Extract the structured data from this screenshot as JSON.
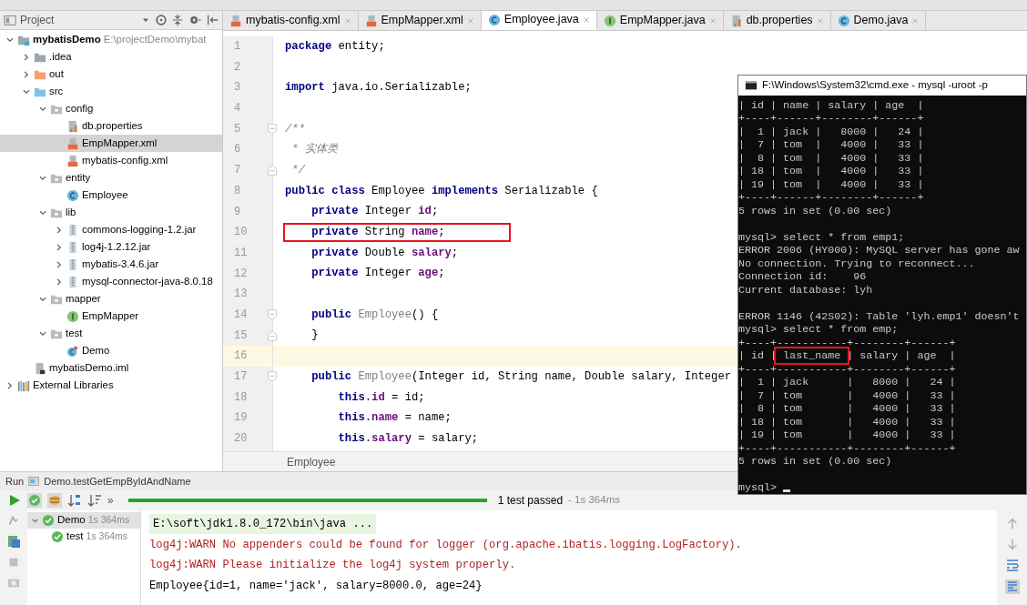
{
  "project_panel": {
    "title": "Project"
  },
  "tree": [
    {
      "label": "mybatisDemo",
      "hint": "E:\\projectDemo\\mybat",
      "kind": "module",
      "expanded": true,
      "selected": false,
      "children": [
        {
          "label": ".idea",
          "kind": "folder",
          "expanded": false,
          "selected": false
        },
        {
          "label": "out",
          "kind": "excluded",
          "expanded": false,
          "selected": false
        },
        {
          "label": "src",
          "kind": "source",
          "expanded": true,
          "selected": false,
          "children": [
            {
              "label": "config",
              "kind": "package",
              "expanded": true,
              "selected": false,
              "children": [
                {
                  "label": "db.properties",
                  "kind": "properties",
                  "selected": false
                },
                {
                  "label": "EmpMapper.xml",
                  "kind": "xml",
                  "selected": true
                },
                {
                  "label": "mybatis-config.xml",
                  "kind": "xml",
                  "selected": false
                }
              ]
            },
            {
              "label": "entity",
              "kind": "package",
              "expanded": true,
              "selected": false,
              "children": [
                {
                  "label": "Employee",
                  "kind": "class",
                  "selected": false
                }
              ]
            },
            {
              "label": "lib",
              "kind": "package",
              "expanded": true,
              "selected": false,
              "children": [
                {
                  "label": "commons-logging-1.2.jar",
                  "kind": "jar",
                  "expanded": false,
                  "selected": false
                },
                {
                  "label": "log4j-1.2.12.jar",
                  "kind": "jar",
                  "expanded": false,
                  "selected": false
                },
                {
                  "label": "mybatis-3.4.6.jar",
                  "kind": "jar",
                  "expanded": false,
                  "selected": false
                },
                {
                  "label": "mysql-connector-java-8.0.18",
                  "kind": "jar",
                  "expanded": false,
                  "selected": false
                }
              ]
            },
            {
              "label": "mapper",
              "kind": "package",
              "expanded": true,
              "selected": false,
              "children": [
                {
                  "label": "EmpMapper",
                  "kind": "interface",
                  "selected": false
                }
              ]
            },
            {
              "label": "test",
              "kind": "package",
              "expanded": true,
              "selected": false,
              "children": [
                {
                  "label": "Demo",
                  "kind": "testclass",
                  "selected": false
                }
              ]
            }
          ]
        },
        {
          "label": "mybatisDemo.iml",
          "kind": "iml",
          "selected": false
        }
      ]
    },
    {
      "label": "External Libraries",
      "kind": "libraries",
      "expanded": false,
      "selected": false
    }
  ],
  "editor_tabs": [
    {
      "label": "mybatis-config.xml",
      "kind": "xml",
      "selected": false
    },
    {
      "label": "EmpMapper.xml",
      "kind": "xml",
      "selected": false
    },
    {
      "label": "Employee.java",
      "kind": "class",
      "selected": true
    },
    {
      "label": "EmpMapper.java",
      "kind": "interface",
      "selected": false
    },
    {
      "label": "db.properties",
      "kind": "properties",
      "selected": false
    },
    {
      "label": "Demo.java",
      "kind": "class",
      "selected": false
    }
  ],
  "code_lines": [
    {
      "number": "1",
      "kind": "plain",
      "current": false,
      "boxed": false,
      "segments": [
        {
          "kind": "kw",
          "text": "package"
        },
        {
          "kind": "plain",
          "text": " entity;"
        }
      ]
    },
    {
      "number": "2",
      "kind": "plain",
      "current": false
    },
    {
      "number": "3",
      "kind": "plain",
      "current": false,
      "boxed": false,
      "segments": [
        {
          "kind": "kw",
          "text": "import"
        },
        {
          "kind": "plain",
          "text": " java.io.Serializable;"
        }
      ]
    },
    {
      "number": "4",
      "kind": "plain",
      "current": false
    },
    {
      "number": "5",
      "kind": "fold-start",
      "current": false,
      "boxed": false,
      "segments": [
        {
          "kind": "comment",
          "text": "/**"
        }
      ]
    },
    {
      "number": "6",
      "kind": "plain",
      "current": false,
      "boxed": false,
      "segments": [
        {
          "kind": "comment",
          "text": " * 实体类"
        }
      ]
    },
    {
      "number": "7",
      "kind": "fold-end",
      "current": false,
      "boxed": false,
      "segments": [
        {
          "kind": "comment",
          "text": " */"
        }
      ]
    },
    {
      "number": "8",
      "kind": "plain",
      "current": false,
      "boxed": false,
      "segments": [
        {
          "kind": "kw",
          "text": "public class"
        },
        {
          "kind": "plain",
          "text": " Employee "
        },
        {
          "kind": "kw",
          "text": "implements"
        },
        {
          "kind": "plain",
          "text": " Serializable {"
        }
      ]
    },
    {
      "number": "9",
      "kind": "plain",
      "current": false,
      "boxed": false,
      "segments": [
        {
          "kind": "kw",
          "text": "    private"
        },
        {
          "kind": "plain",
          "text": " Integer "
        },
        {
          "kind": "field",
          "text": "id"
        },
        {
          "kind": "plain",
          "text": ";"
        }
      ]
    },
    {
      "number": "10",
      "kind": "plain",
      "current": false,
      "boxed": true,
      "segments": [
        {
          "kind": "kw",
          "text": "    private"
        },
        {
          "kind": "plain",
          "text": " String "
        },
        {
          "kind": "field",
          "text": "name"
        },
        {
          "kind": "plain",
          "text": ";"
        }
      ]
    },
    {
      "number": "11",
      "kind": "plain",
      "current": false,
      "boxed": false,
      "segments": [
        {
          "kind": "kw",
          "text": "    private"
        },
        {
          "kind": "plain",
          "text": " Double "
        },
        {
          "kind": "field",
          "text": "salary"
        },
        {
          "kind": "plain",
          "text": ";"
        }
      ]
    },
    {
      "number": "12",
      "kind": "plain",
      "current": false,
      "boxed": false,
      "segments": [
        {
          "kind": "kw",
          "text": "    private"
        },
        {
          "kind": "plain",
          "text": " Integer "
        },
        {
          "kind": "field",
          "text": "age"
        },
        {
          "kind": "plain",
          "text": ";"
        }
      ]
    },
    {
      "number": "13",
      "kind": "plain",
      "current": false
    },
    {
      "number": "14",
      "kind": "fold-start",
      "current": false,
      "boxed": false,
      "segments": [
        {
          "kind": "kw",
          "text": "    public"
        },
        {
          "kind": "unused",
          "text": " Employee"
        },
        {
          "kind": "plain",
          "text": "() {"
        }
      ]
    },
    {
      "number": "15",
      "kind": "fold-end",
      "current": false,
      "boxed": false,
      "segments": [
        {
          "kind": "plain",
          "text": "    }"
        }
      ]
    },
    {
      "number": "16",
      "kind": "plain",
      "current": true
    },
    {
      "number": "17",
      "kind": "fold-start",
      "current": false,
      "boxed": false,
      "segments": [
        {
          "kind": "kw",
          "text": "    public"
        },
        {
          "kind": "unused",
          "text": " Employee"
        },
        {
          "kind": "plain",
          "text": "(Integer id, String name, Double salary, Integer"
        }
      ]
    },
    {
      "number": "18",
      "kind": "plain",
      "current": false,
      "boxed": false,
      "segments": [
        {
          "kind": "kw",
          "text": "        this"
        },
        {
          "kind": "plain",
          "text": "."
        },
        {
          "kind": "field",
          "text": "id"
        },
        {
          "kind": "plain",
          "text": " = id;"
        }
      ]
    },
    {
      "number": "19",
      "kind": "plain",
      "current": false,
      "boxed": false,
      "segments": [
        {
          "kind": "kw",
          "text": "        this"
        },
        {
          "kind": "plain",
          "text": "."
        },
        {
          "kind": "field",
          "text": "name"
        },
        {
          "kind": "plain",
          "text": " = name;"
        }
      ]
    },
    {
      "number": "20",
      "kind": "plain",
      "current": false,
      "boxed": false,
      "segments": [
        {
          "kind": "kw",
          "text": "        this"
        },
        {
          "kind": "plain",
          "text": "."
        },
        {
          "kind": "field",
          "text": "salary"
        },
        {
          "kind": "plain",
          "text": " = salary;"
        }
      ]
    }
  ],
  "editor_breadcrumb": "Employee",
  "cmd_window": {
    "title": "F:\\Windows\\System32\\cmd.exe - mysql  -uroot -p",
    "blocks": [
      {
        "lines": [
          {
            "text": "| id | name | salary | age  |"
          },
          {
            "text": "+----+------+--------+------+"
          },
          {
            "text": "|  1 | jack |   8000 |   24 |"
          },
          {
            "text": "|  7 | tom  |   4000 |   33 |"
          },
          {
            "text": "|  8 | tom  |   4000 |   33 |"
          },
          {
            "text": "| 18 | tom  |   4000 |   33 |"
          },
          {
            "text": "| 19 | tom  |   4000 |   33 |"
          },
          {
            "text": "+----+------+--------+------+"
          },
          {
            "text": "5 rows in set (0.00 sec)"
          }
        ]
      },
      {
        "lines": [
          {
            "text": "mysql> select * from emp1;"
          },
          {
            "text": "ERROR 2006 (HY000): MySQL server has gone aw"
          },
          {
            "text": "No connection. Trying to reconnect..."
          },
          {
            "text": "Connection id:    96"
          },
          {
            "text": "Current database: lyh"
          }
        ]
      },
      {
        "lines": [
          {
            "text": "ERROR 1146 (42S02): Table 'lyh.emp1' doesn't"
          },
          {
            "text": "mysql> select * from emp;"
          },
          {
            "text": "+----+-----------+--------+------+"
          },
          {
            "parts": [
              {
                "text": "| id |",
                "boxed": false
              },
              {
                "text": " last_name ",
                "boxed": true
              },
              {
                "text": "| salary | age  |",
                "boxed": false
              }
            ]
          },
          {
            "text": "+----+-----------+--------+------+"
          },
          {
            "text": "|  1 | jack      |   8000 |   24 |"
          },
          {
            "text": "|  7 | tom       |   4000 |   33 |"
          },
          {
            "text": "|  8 | tom       |   4000 |   33 |"
          },
          {
            "text": "| 18 | tom       |   4000 |   33 |"
          },
          {
            "text": "| 19 | tom       |   4000 |   33 |"
          },
          {
            "text": "+----+-----------+--------+------+"
          },
          {
            "text": "5 rows in set (0.00 sec)"
          }
        ]
      },
      {
        "lines": [
          {
            "text": "mysql>",
            "cursor": true
          }
        ]
      }
    ]
  },
  "run_panel": {
    "label": "Run",
    "config": "Demo.testGetEmpByIdAndName",
    "more": "»",
    "progress": {
      "level": 1
    },
    "status": "1 test passed",
    "duration": "- 1s 364ms",
    "tests": [
      {
        "label": "Demo",
        "time": "1s 364ms",
        "expanded": true,
        "selected": true,
        "children": [
          {
            "label": "test",
            "time": "1s 364ms",
            "selected": false
          }
        ]
      }
    ],
    "console": [
      {
        "kind": "command",
        "text": "E:\\soft\\jdk1.8.0_172\\bin\\java ..."
      },
      {
        "kind": "warn",
        "text": "log4j:WARN No appenders could be found for logger (org.apache.ibatis.logging.LogFactory)."
      },
      {
        "kind": "warn",
        "text": "log4j:WARN Please initialize the log4j system properly."
      },
      {
        "kind": "out",
        "text": "Employee{id=1, name='jack', salary=8000.0, age=24}"
      }
    ]
  }
}
